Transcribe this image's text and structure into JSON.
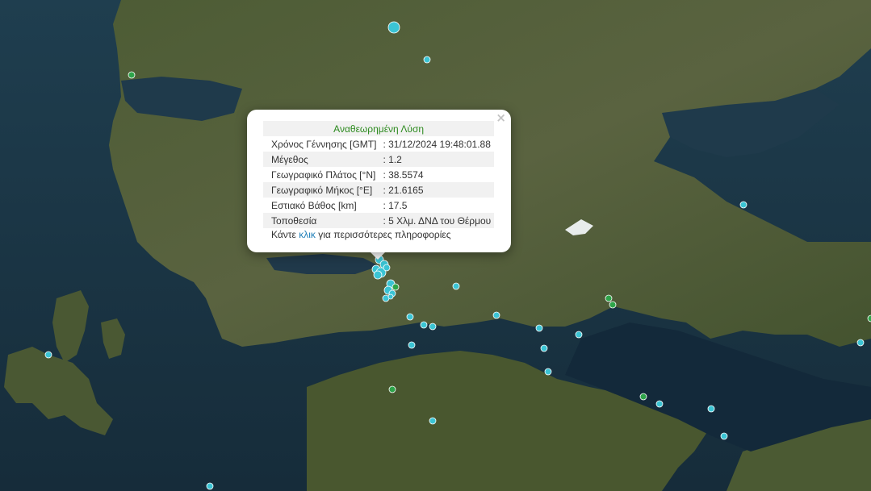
{
  "popup": {
    "title": "Αναθεωρημένη Λύση",
    "rows": [
      {
        "label": "Χρόνος Γέννησης [GMT]",
        "value": ": 31/12/2024 19:48:01.88"
      },
      {
        "label": "Μέγεθος",
        "value": ": 1.2"
      },
      {
        "label": "Γεωγραφικό Πλάτος [°N]",
        "value": ": 38.5574"
      },
      {
        "label": "Γεωγραφικό Μήκος [°E]",
        "value": ": 21.6165"
      },
      {
        "label": "Εστιακό Βάθος [km]",
        "value": ": 17.5"
      },
      {
        "label": "Τοποθεσία",
        "value": ": 5 Χλμ. ΔΝΔ του Θέρμου"
      }
    ],
    "more_prefix": "Κάντε",
    "more_link": "κλικ",
    "more_suffix": "για περισσότερες πληροφορίες",
    "close_glyph": "×"
  },
  "colors": {
    "marker_cyan": "#3bc4d4",
    "marker_green": "#2ea44a",
    "sea": "#1d3a4a",
    "land": "#4a5a34",
    "title_green": "#2c8a1e",
    "link_blue": "#1f7fb8"
  }
}
